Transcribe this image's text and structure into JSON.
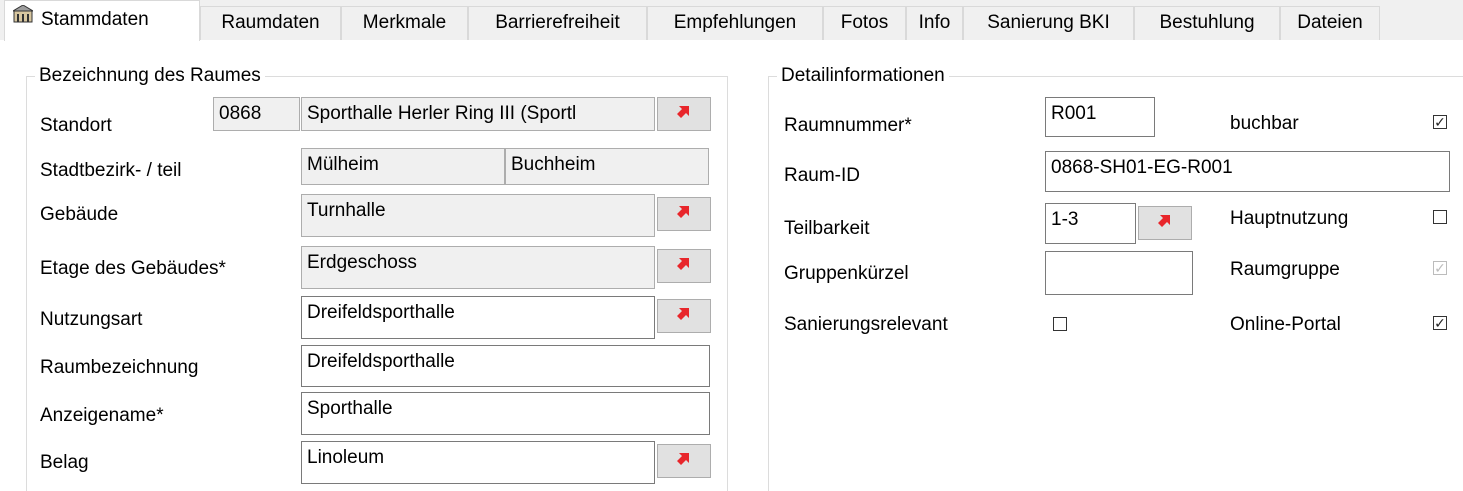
{
  "tabs": [
    "Stammdaten",
    "Raumdaten",
    "Merkmale",
    "Barrierefreiheit",
    "Empfehlungen",
    "Fotos",
    "Info",
    "Sanierung BKI",
    "Bestuhlung",
    "Dateien"
  ],
  "left_group": {
    "title": "Bezeichnung des Raumes",
    "standort": {
      "label": "Standort",
      "code": "0868",
      "name": "Sporthalle Herler Ring III (Sportl"
    },
    "stadtbezirk": {
      "label": "Stadtbezirk- / teil",
      "bezirk": "Mülheim",
      "teil": "Buchheim"
    },
    "gebaeude": {
      "label": "Gebäude",
      "value": "Turnhalle"
    },
    "etage": {
      "label": "Etage des Gebäudes*",
      "value": "Erdgeschoss"
    },
    "nutzungsart": {
      "label": "Nutzungsart",
      "value": "Dreifeldsporthalle"
    },
    "raumbezeichnung": {
      "label": "Raumbezeichnung",
      "value": "Dreifeldsporthalle"
    },
    "anzeigename": {
      "label": "Anzeigename*",
      "value": "Sporthalle"
    },
    "belag": {
      "label": "Belag",
      "value": "Linoleum"
    }
  },
  "right_group": {
    "title": "Detailinformationen",
    "raumnummer": {
      "label": "Raumnummer*",
      "value": "R001"
    },
    "raum_id": {
      "label": "Raum-ID",
      "value": "0868-SH01-EG-R001"
    },
    "teilbarkeit": {
      "label": "Teilbarkeit",
      "value": "1-3"
    },
    "gruppenkuerzel": {
      "label": "Gruppenkürzel",
      "value": ""
    },
    "sanierungsrelevant": {
      "label": "Sanierungsrelevant",
      "checked": false
    },
    "buchbar": {
      "label": "buchbar",
      "checked": true
    },
    "hauptnutzung": {
      "label": "Hauptnutzung",
      "checked": false
    },
    "raumgruppe": {
      "label": "Raumgruppe",
      "checked": true,
      "disabled": true
    },
    "online_portal": {
      "label": "Online-Portal",
      "checked": true
    }
  },
  "colors": {
    "pick_arrow": "#e8262b",
    "tab_border": "#d9d9d9"
  }
}
